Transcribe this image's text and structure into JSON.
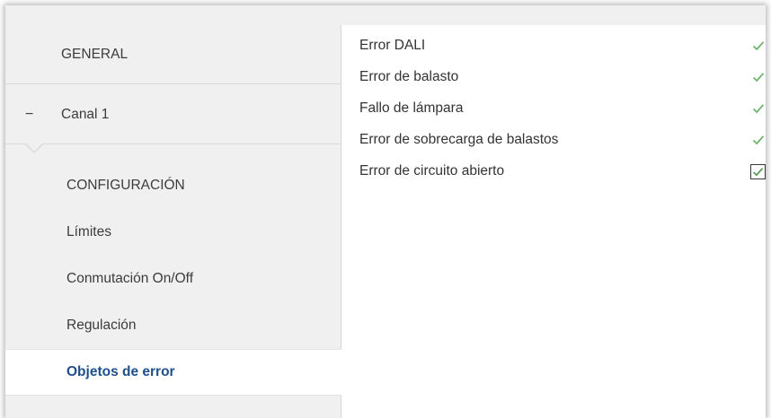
{
  "sidebar": {
    "general_label": "GENERAL",
    "canal_label": "Canal 1",
    "canal_toggle": "−",
    "sub_items": [
      {
        "label": "CONFIGURACIÓN"
      },
      {
        "label": "Límites"
      },
      {
        "label": "Conmutación On/Off"
      },
      {
        "label": "Regulación"
      },
      {
        "label": "Objetos de error"
      }
    ],
    "active_item": "Objetos de error"
  },
  "content": {
    "rows": [
      {
        "label": "Error DALI",
        "checked": true,
        "icon": "checkmark-icon"
      },
      {
        "label": "Error de balasto",
        "checked": true,
        "icon": "checkmark-icon"
      },
      {
        "label": "Fallo de lámpara",
        "checked": true,
        "icon": "checkmark-icon"
      },
      {
        "label": "Error de sobrecarga de balastos",
        "checked": true,
        "icon": "checkmark-icon"
      },
      {
        "label": "Error de circuito abierto",
        "checked": true,
        "icon": "checkbox-checked-icon"
      }
    ]
  },
  "colors": {
    "sidebar_bg": "#f0f0f0",
    "active_text": "#1f4f8b",
    "check_green": "#6bb36b",
    "text": "#333333"
  }
}
